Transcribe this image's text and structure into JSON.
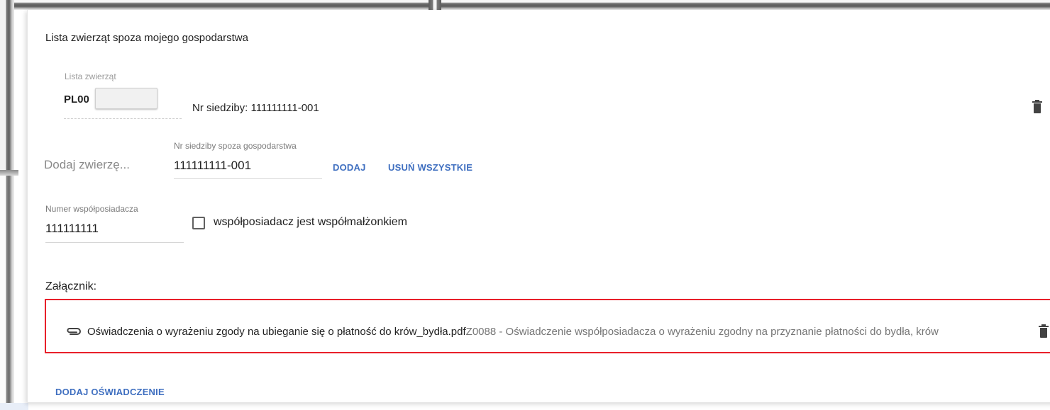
{
  "section": {
    "title": "Lista zwierząt spoza mojego gospodarstwa"
  },
  "animal_list": {
    "label": "Lista zwierząt",
    "value_prefix": "PL00",
    "farm_number_text": "Nr siedziby: 111111111-001"
  },
  "add_animal": {
    "placeholder": "Dodaj zwierzę...",
    "external_farm_label": "Nr siedziby spoza gospodarstwa",
    "external_farm_value": "111111111-001",
    "add_button": "DODAJ",
    "remove_all_button": "USUŃ WSZYSTKIE"
  },
  "co_owner": {
    "label": "Numer współposiadacza",
    "value": "111111111",
    "spouse_checkbox_label": "współposiadacz jest współmałżonkiem",
    "spouse_checked": false
  },
  "attachment": {
    "label": "Załącznik:",
    "file_name": "Oświadczenia o wyrażeniu zgody na ubieganie się o płatność do krów_bydła.pdf",
    "file_description": "Z0088 - Oświadczenie współposiadacza o wyrażeniu zgodny na przyznanie płatności do bydła, krów",
    "highlight_color": "#e8202a"
  },
  "actions": {
    "add_statement_button": "DODAJ OŚWIADCZENIE"
  },
  "icons": {
    "delete": "trash-icon",
    "attachment": "paperclip-icon"
  },
  "colors": {
    "link": "#3f6fc0",
    "text": "#212121",
    "muted": "#757575"
  }
}
